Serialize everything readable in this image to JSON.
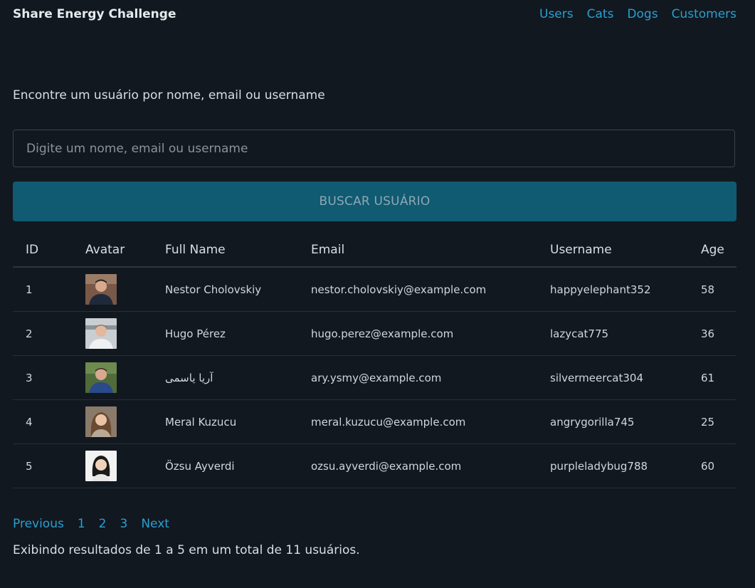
{
  "navbar": {
    "brand": "Share Energy Challenge",
    "links": [
      "Users",
      "Cats",
      "Dogs",
      "Customers"
    ]
  },
  "search": {
    "heading": "Encontre um usuário por nome, email ou username",
    "placeholder": "Digite um nome, email ou username",
    "value": "",
    "button_label": "BUSCAR USUÁRIO"
  },
  "table": {
    "headers": [
      "ID",
      "Avatar",
      "Full Name",
      "Email",
      "Username",
      "Age"
    ],
    "rows": [
      {
        "id": "1",
        "full_name": "Nestor Cholovskiy",
        "email": "nestor.cholovskiy@example.com",
        "username": "happyelephant352",
        "age": "58",
        "avatar": "avatar-photo"
      },
      {
        "id": "2",
        "full_name": "Hugo Pérez",
        "email": "hugo.perez@example.com",
        "username": "lazycat775",
        "age": "36",
        "avatar": "avatar-photo"
      },
      {
        "id": "3",
        "full_name": "آریا یاسمی",
        "email": "ary.ysmy@example.com",
        "username": "silvermeercat304",
        "age": "61",
        "avatar": "avatar-photo"
      },
      {
        "id": "4",
        "full_name": "Meral Kuzucu",
        "email": "meral.kuzucu@example.com",
        "username": "angrygorilla745",
        "age": "25",
        "avatar": "avatar-photo"
      },
      {
        "id": "5",
        "full_name": "Özsu Ayverdi",
        "email": "ozsu.ayverdi@example.com",
        "username": "purpleladybug788",
        "age": "60",
        "avatar": "avatar-photo"
      }
    ]
  },
  "pagination": {
    "previous_label": "Previous",
    "pages": [
      "1",
      "2",
      "3"
    ],
    "next_label": "Next"
  },
  "results_text": "Exibindo resultados de 1 a 5 em um total de 11 usuários.",
  "colors": {
    "background": "#111820",
    "link": "#2a9fd0",
    "button": "#105a72"
  }
}
